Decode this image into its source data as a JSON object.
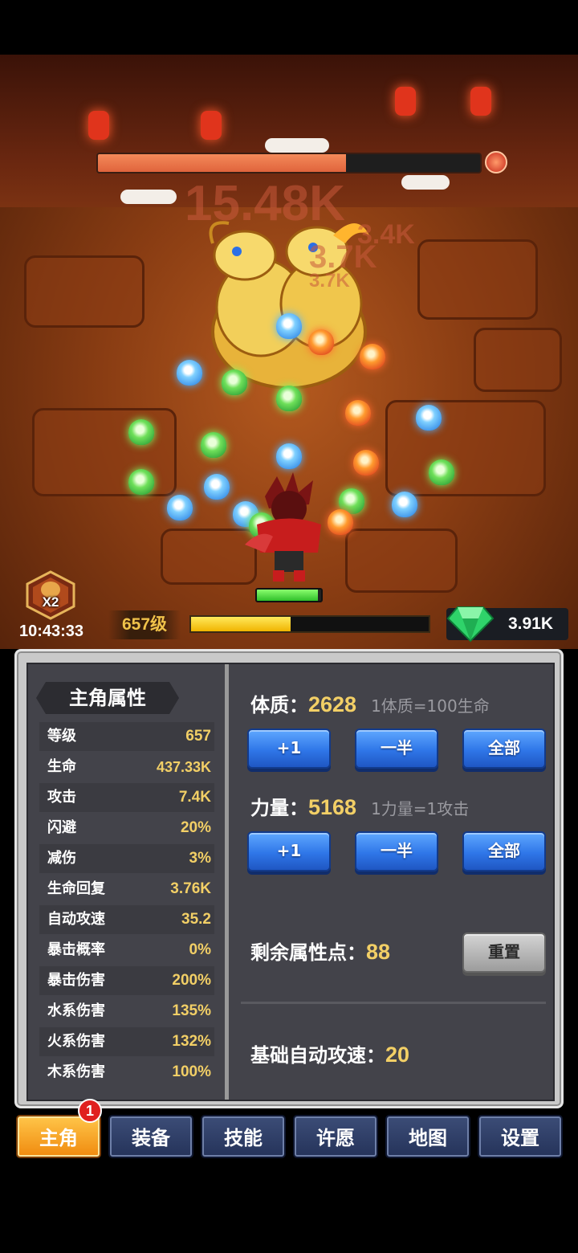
{
  "battle": {
    "damage_numbers": [
      "15.48K",
      "3.4K",
      "3.7K",
      "3.7K"
    ],
    "boss_hp_fraction": 0.65,
    "hero_hp_fraction": 0.95
  },
  "hud": {
    "speed_badge": "X2",
    "clock": "10:43:33",
    "level": "657级",
    "xp_fraction": 0.42,
    "gems": "3.91K"
  },
  "stats_panel": {
    "title": "主角属性",
    "rows": [
      {
        "label": "等级",
        "value": "657"
      },
      {
        "label": "生命",
        "value": "437.33K"
      },
      {
        "label": "攻击",
        "value": "7.4K"
      },
      {
        "label": "闪避",
        "value": "20%"
      },
      {
        "label": "减伤",
        "value": "3%"
      },
      {
        "label": "生命回复",
        "value": "3.76K"
      },
      {
        "label": "自动攻速",
        "value": "35.2"
      },
      {
        "label": "暴击概率",
        "value": "0%"
      },
      {
        "label": "暴击伤害",
        "value": "200%"
      },
      {
        "label": "水系伤害",
        "value": "135%"
      },
      {
        "label": "火系伤害",
        "value": "132%"
      },
      {
        "label": "木系伤害",
        "value": "100%"
      }
    ]
  },
  "attributes": {
    "constitution": {
      "label": "体质：",
      "value": "2628",
      "hint": "1体质=100生命"
    },
    "strength": {
      "label": "力量：",
      "value": "5168",
      "hint": "1力量=1攻击"
    },
    "buttons": {
      "plus_one": "+1",
      "half": "一半",
      "all": "全部"
    },
    "remaining": {
      "label": "剩余属性点：",
      "value": "88"
    },
    "reset_label": "重置",
    "base_speed": {
      "label": "基础自动攻速：",
      "value": "20"
    }
  },
  "tabs": [
    {
      "label": "主角"
    },
    {
      "label": "装备"
    },
    {
      "label": "技能"
    },
    {
      "label": "许愿"
    },
    {
      "label": "地图"
    },
    {
      "label": "设置"
    }
  ],
  "tab_badge": "1",
  "colors": {
    "accent_gold": "#f2cf66",
    "button_blue": "#2f76e8",
    "active_tab": "#f08a0e",
    "gem_green": "#2fd36a"
  }
}
